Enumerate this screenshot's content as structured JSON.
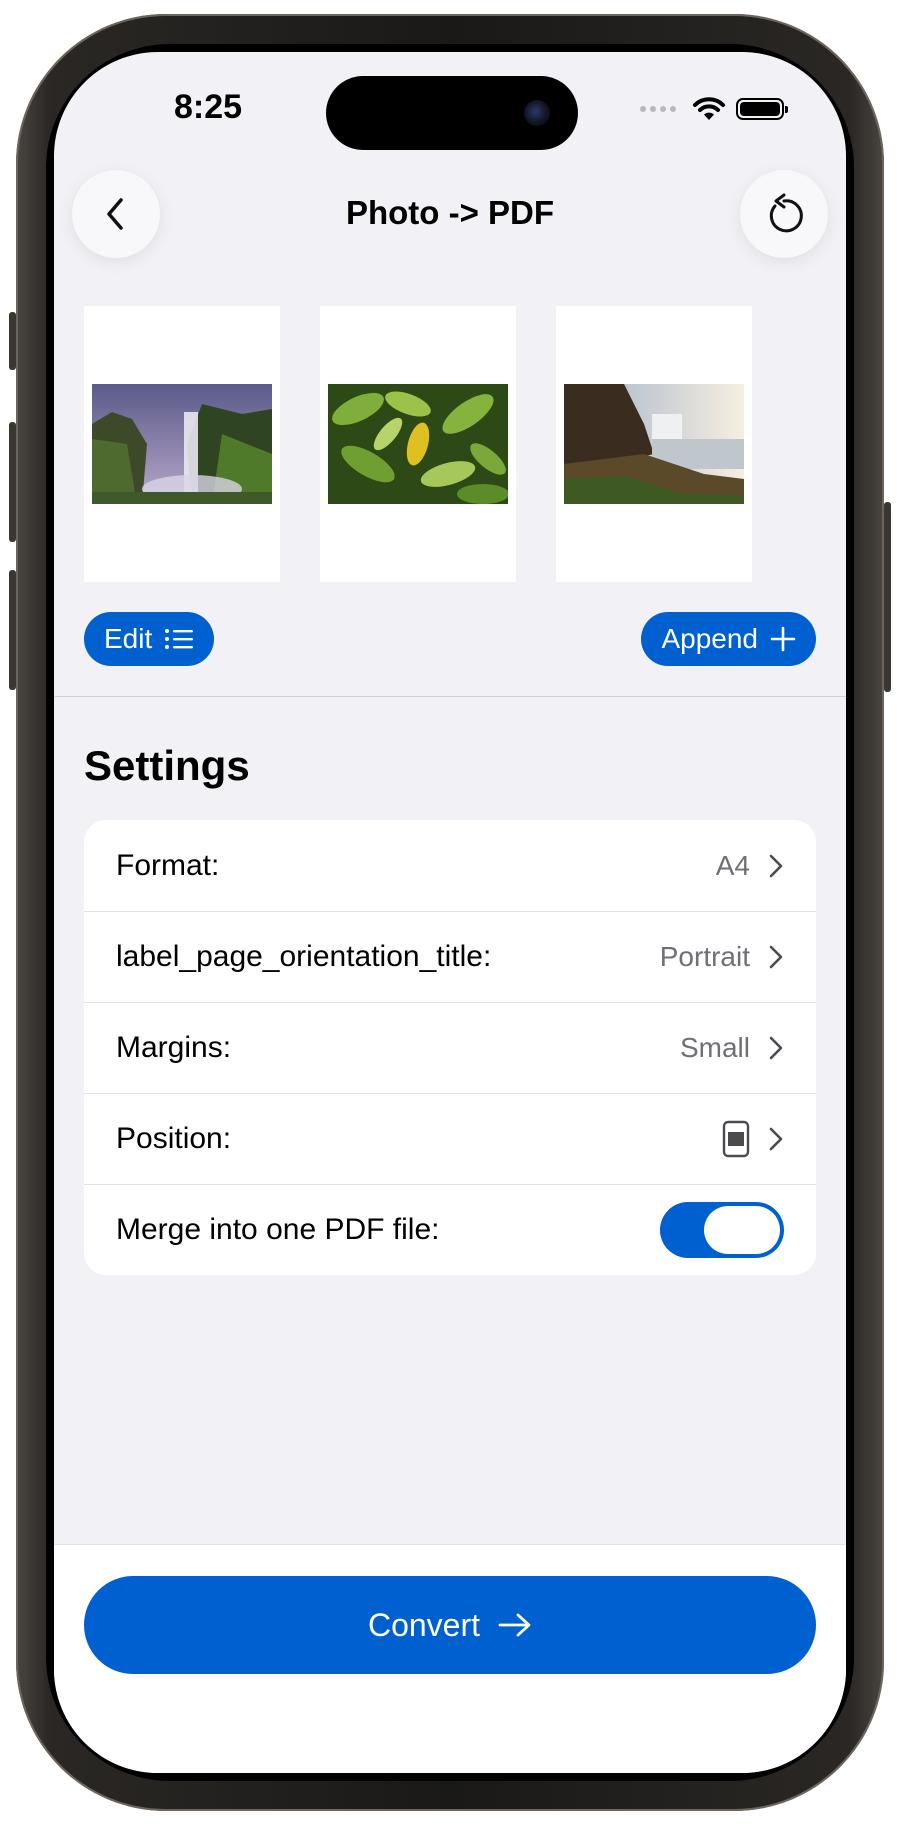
{
  "status_bar": {
    "time": "8:25"
  },
  "nav": {
    "title": "Photo -> PDF",
    "back_icon": "chevron-left-icon",
    "reset_icon": "rotate-ccw-icon"
  },
  "pages": [
    {
      "name": "page-thumbnail-waterfall"
    },
    {
      "name": "page-thumbnail-leaves"
    },
    {
      "name": "page-thumbnail-coast-waterfall"
    }
  ],
  "actions": {
    "edit_label": "Edit",
    "append_label": "Append"
  },
  "settings": {
    "title": "Settings",
    "rows": [
      {
        "label": "Format:",
        "value": "A4"
      },
      {
        "label": "label_page_orientation_title:",
        "value": "Portrait"
      },
      {
        "label": "Margins:",
        "value": "Small"
      },
      {
        "label": "Position:",
        "value": ""
      },
      {
        "label": "Merge into one PDF file:",
        "toggle_on": true
      }
    ]
  },
  "convert_label": "Convert",
  "colors": {
    "accent": "#0060d0",
    "background": "#f1f1f6"
  }
}
